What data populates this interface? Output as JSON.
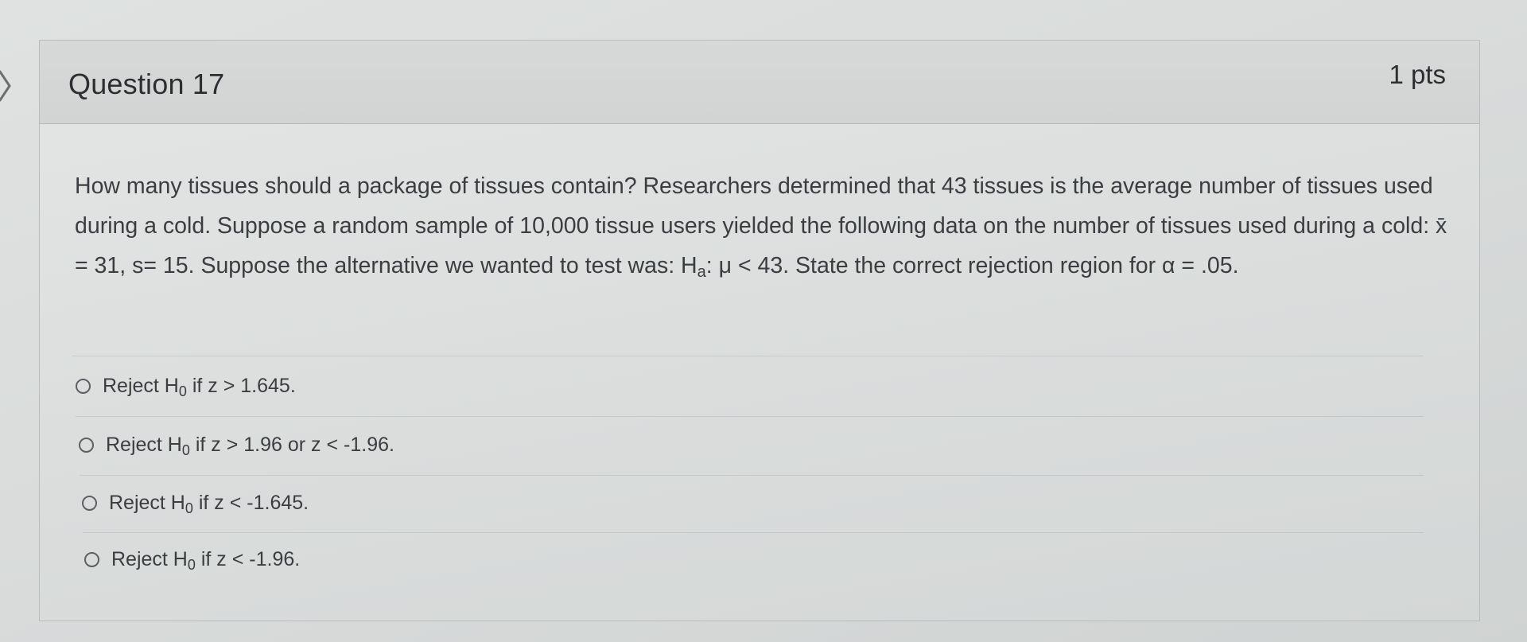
{
  "question": {
    "title": "Question 17",
    "points": "1 pts",
    "text_part1": "How many tissues should a package of tissues contain? Researchers determined that 43 tissues is the average number of tissues used during a cold. Suppose a random sample of 10,000 tissue users yielded the following data on the number of tissues used during a cold: x̄ = 31, s= 15. Suppose the alternative we wanted to test was: H",
    "text_sub": "a",
    "text_part2": ": μ < 43. State the correct rejection region for α = .05."
  },
  "answers": [
    {
      "prefix": "Reject H",
      "sub": "0",
      "suffix": " if z > 1.645."
    },
    {
      "prefix": "Reject H",
      "sub": "0",
      "suffix": " if z > 1.96 or z < -1.96."
    },
    {
      "prefix": "Reject H",
      "sub": "0",
      "suffix": " if z < -1.645."
    },
    {
      "prefix": "Reject H",
      "sub": "0",
      "suffix": " if z < -1.96."
    }
  ],
  "colors": {
    "background": "#dadddc",
    "text": "#3a3e41",
    "title": "#2b2f31",
    "border": "#b9bdbc"
  }
}
